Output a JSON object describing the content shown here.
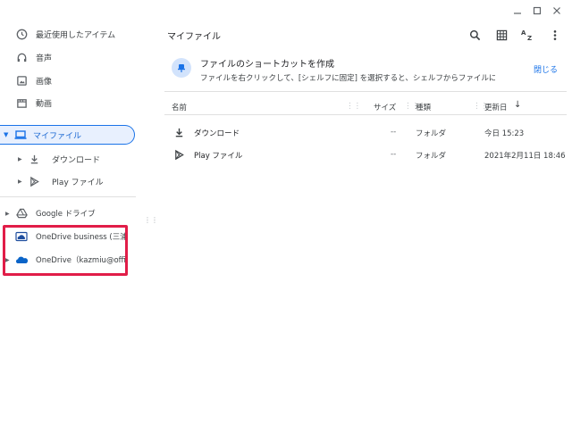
{
  "window": {
    "controls": [
      "minimize-icon",
      "maximize-icon",
      "close-icon"
    ]
  },
  "sidebar": {
    "recent": "最近使用したアイテム",
    "audio": "音声",
    "images": "画像",
    "videos": "動画",
    "my_files": "マイファイル",
    "downloads": "ダウンロード",
    "play_files": "Play ファイル",
    "google_drive": "Google ドライブ",
    "onedrive_business": "OneDrive business (三浦…",
    "onedrive_personal": "OneDrive（kazmiu@offic…"
  },
  "main": {
    "title": "マイファイル",
    "toolbar": [
      "search-icon",
      "grid-view-icon",
      "sort-az-icon",
      "more-vert-icon"
    ],
    "banner": {
      "title": "ファイルのショートカットを作成",
      "description": "ファイルを右クリックして、[シェルフに固定] を選択すると、シェルフからファイルに...",
      "close_label": "閉じる"
    },
    "table": {
      "headers": {
        "name": "名前",
        "size": "サイズ",
        "type": "種類",
        "modified": "更新日"
      },
      "rows": [
        {
          "icon": "download-icon",
          "name": "ダウンロード",
          "size": "--",
          "type": "フォルダ",
          "modified": "今日 15:23"
        },
        {
          "icon": "play-store-icon",
          "name": "Play ファイル",
          "size": "--",
          "type": "フォルダ",
          "modified": "2021年2月11日 18:46"
        }
      ]
    }
  },
  "colors": {
    "accent": "#1a73e8",
    "selected_bg": "#e8f0fe",
    "highlight_border": "#e11d48"
  }
}
